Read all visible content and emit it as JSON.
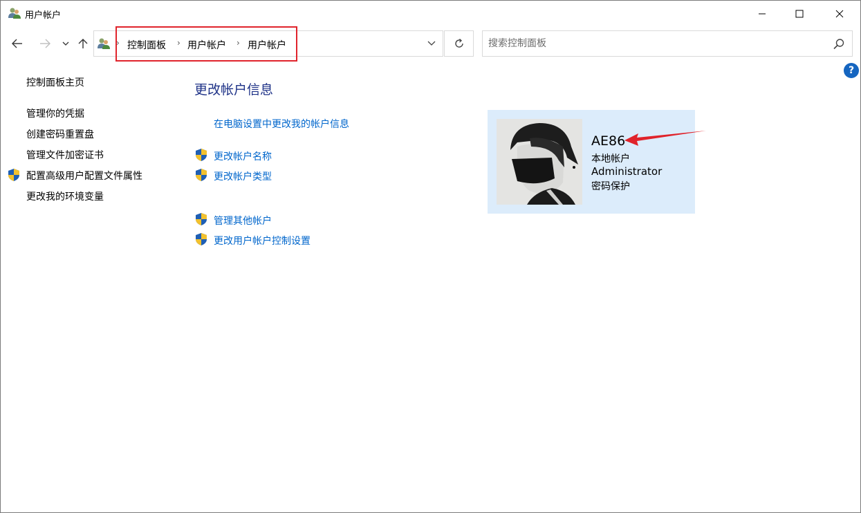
{
  "window": {
    "title": "用户帐户",
    "icon": "users-icon",
    "controls": [
      "minimize-icon",
      "maximize-icon",
      "close-icon"
    ]
  },
  "navigation": {
    "breadcrumb": [
      "控制面板",
      "用户帐户",
      "用户帐户"
    ],
    "search_placeholder": "搜索控制面板",
    "help_label": "?"
  },
  "sidebar": {
    "home": "控制面板主页",
    "items": [
      {
        "label": "管理你的凭据",
        "shield": false
      },
      {
        "label": "创建密码重置盘",
        "shield": false
      },
      {
        "label": "管理文件加密证书",
        "shield": false
      },
      {
        "label": "配置高级用户配置文件属性",
        "shield": true
      },
      {
        "label": "更改我的环境变量",
        "shield": false
      }
    ]
  },
  "main": {
    "title": "更改帐户信息",
    "pc_settings_link": "在电脑设置中更改我的帐户信息",
    "tasks": [
      {
        "label": "更改帐户名称",
        "shield": true
      },
      {
        "label": "更改帐户类型",
        "shield": true
      },
      {
        "label": "管理其他帐户",
        "shield": true
      },
      {
        "label": "更改用户帐户控制设置",
        "shield": true
      }
    ]
  },
  "account": {
    "name": "AE86",
    "type": "本地帐户",
    "role": "Administrator",
    "protection": "密码保护"
  },
  "colors": {
    "link": "#0066cc",
    "title": "#1e3287",
    "card_bg": "#dcecfb",
    "annotation": "#e0232b"
  }
}
